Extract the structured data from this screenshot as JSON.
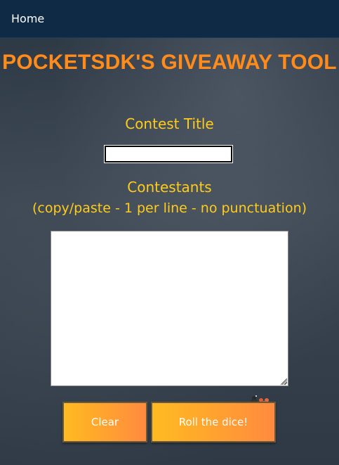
{
  "nav": {
    "home_label": "Home"
  },
  "page": {
    "title": "POCKETSDK'S GIVEAWAY TOOL",
    "contest_title_label": "Contest Title",
    "contestants_label": "Contestants",
    "contestants_hint": "(copy/paste - 1 per line - no punctuation)"
  },
  "form": {
    "contest_title_value": "",
    "contestants_value": ""
  },
  "buttons": {
    "clear_label": "Clear",
    "roll_label": "Roll the dice!"
  },
  "colors": {
    "navbar": "#0e2a45",
    "title": "#ff8c1a",
    "labels": "#ffcc1a",
    "button_gradient_start": "#ffbb22",
    "button_gradient_end": "#ff8a40"
  },
  "icons": {
    "decoration": "dice-icon"
  }
}
